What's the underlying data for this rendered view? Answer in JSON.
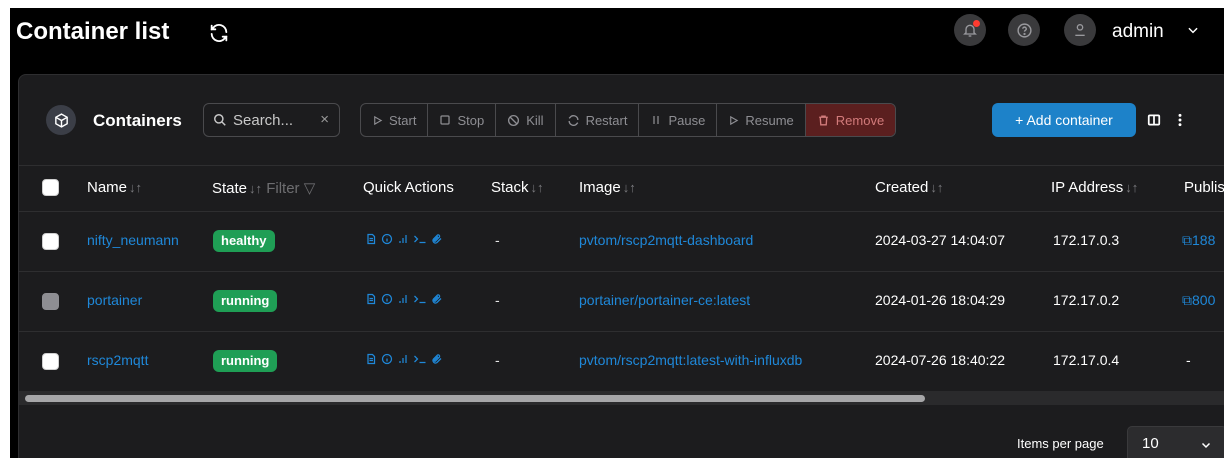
{
  "header": {
    "title": "Container list",
    "user": "admin"
  },
  "card": {
    "title": "Containers",
    "search_placeholder": "Search...",
    "search_clear": "×",
    "actions": [
      "Start",
      "Stop",
      "Kill",
      "Restart",
      "Pause",
      "Resume",
      "Remove"
    ],
    "add_label": "+ Add container"
  },
  "table": {
    "columns": {
      "name": "Name",
      "state": "State",
      "state_filter": "Filter",
      "quick_actions": "Quick Actions",
      "stack": "Stack",
      "image": "Image",
      "created": "Created",
      "ip": "IP Address",
      "published": "Publis"
    },
    "sort_glyph": "↓↑",
    "rows": [
      {
        "name": "nifty_neumann",
        "state": "healthy",
        "stack": "-",
        "image": "pvtom/rscp2mqtt-dashboard",
        "created": "2024-03-27 14:04:07",
        "ip": "172.17.0.3",
        "published": "188"
      },
      {
        "name": "portainer",
        "state": "running",
        "stack": "-",
        "image": "portainer/portainer-ce:latest",
        "created": "2024-01-26 18:04:29",
        "ip": "172.17.0.2",
        "published": "800"
      },
      {
        "name": "rscp2mqtt",
        "state": "running",
        "stack": "-",
        "image": "pvtom/rscp2mqtt:latest-with-influxdb",
        "created": "2024-07-26 18:40:22",
        "ip": "172.17.0.4",
        "published": "-"
      }
    ]
  },
  "footer": {
    "items_per_page_label": "Items per page",
    "items_per_page_value": "10"
  },
  "colors": {
    "accent": "#1d82c9",
    "badge_green": "#1f9e55",
    "link": "#1f88d9",
    "remove_bg": "#5b1f1f"
  }
}
